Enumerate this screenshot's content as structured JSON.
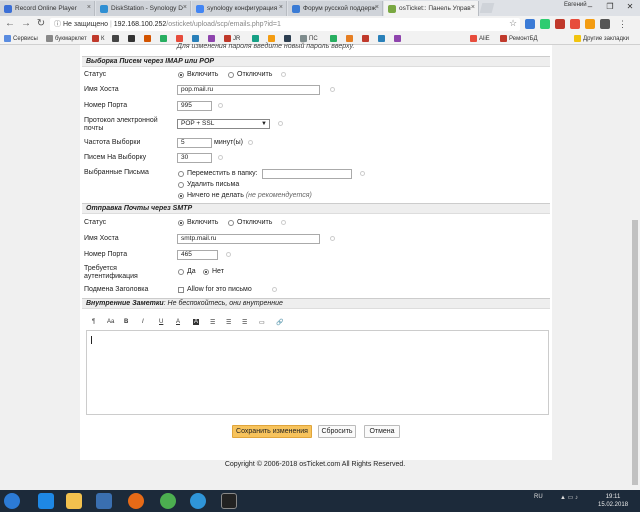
{
  "browser": {
    "tabs": [
      {
        "title": "Record Online Player",
        "favcolor": "#3b6fd6"
      },
      {
        "title": "DiskStation - Synology D",
        "favcolor": "#2f8fd3"
      },
      {
        "title": "synology конфигурация",
        "favcolor": "#4285f4"
      },
      {
        "title": "Форум русской поддерж",
        "favcolor": "#3a7bd5"
      },
      {
        "title": "osTicket:: Панель Управ",
        "favcolor": "#7aa842"
      }
    ],
    "user_label": "Евгений",
    "window_buttons": [
      "–",
      "❐",
      "✕"
    ],
    "url_security": "Не защищено",
    "url_host": "192.168.100.252",
    "url_path": "/osticket/upload/scp/emails.php?id=1"
  },
  "bookmarks": [
    {
      "label": "Сервисы",
      "color": "#5a8ce0"
    },
    {
      "label": "букмарклет",
      "color": "#888888"
    },
    {
      "label": "К",
      "color": "#c0392b"
    },
    {
      "label": "",
      "color": "#444444"
    },
    {
      "label": "",
      "color": "#333333"
    },
    {
      "label": "",
      "color": "#d35400"
    },
    {
      "label": "",
      "color": "#27ae60"
    },
    {
      "label": "",
      "color": "#e74c3c"
    },
    {
      "label": "",
      "color": "#2980b9"
    },
    {
      "label": "",
      "color": "#8e44ad"
    },
    {
      "label": "JR",
      "color": "#c0392b"
    },
    {
      "label": "",
      "color": "#16a085"
    },
    {
      "label": "",
      "color": "#f39c12"
    },
    {
      "label": "",
      "color": "#2c3e50"
    },
    {
      "label": "ПС",
      "color": "#7f8c8d"
    },
    {
      "label": "",
      "color": "#27ae60"
    },
    {
      "label": "",
      "color": "#e67e22"
    },
    {
      "label": "",
      "color": "#c0392b"
    },
    {
      "label": "",
      "color": "#2980b9"
    },
    {
      "label": "",
      "color": "#8e44ad"
    },
    {
      "label": "AliE",
      "color": "#e74c3c"
    },
    {
      "label": "РемонтБД",
      "color": "#c0392b"
    },
    {
      "label": "Другие закладки",
      "color": "#f1c40f"
    }
  ],
  "page": {
    "top_hint": "Для изменения пароля введите новый пароль вверху.",
    "imap": {
      "heading": "Выборка Писем через IMAP или POP",
      "status_label": "Статус",
      "status_on": "Включить",
      "status_off": "Отключить",
      "host_label": "Имя Хоста",
      "host_value": "pop.mail.ru",
      "port_label": "Номер Порта",
      "port_value": "995",
      "protocol_label_1": "Протокол электронной",
      "protocol_label_2": "почты",
      "protocol_value": "POP + SSL",
      "freq_label": "Частота Выборки",
      "freq_value": "5",
      "freq_unit": "минут(ы)",
      "perfetch_label": "Писем На Выборку",
      "perfetch_value": "30",
      "fetched_label": "Выбранные Письма",
      "opt_move": "Переместить в папку:",
      "opt_delete": "Удалить письма",
      "opt_nothing": "Ничего не делать",
      "opt_nothing_note": "(не рекомендуется)"
    },
    "smtp": {
      "heading": "Отправка Почты через SMTP",
      "status_label": "Статус",
      "status_on": "Включить",
      "status_off": "Отключить",
      "host_label": "Имя Хоста",
      "host_value": "smtp.mail.ru",
      "port_label": "Номер Порта",
      "port_value": "465",
      "auth_label_1": "Требуется",
      "auth_label_2": "аутентификация",
      "auth_yes": "Да",
      "auth_no": "Нет",
      "spoof_label": "Подмена Заголовка",
      "spoof_option": "Allow for это письмо"
    },
    "notes": {
      "heading": "Внутренние Заметки",
      "subheading": ": Не беспокойтесь, они внутренние",
      "toolbar": [
        "¶",
        "Aa",
        "B",
        "I",
        "U",
        "A",
        "A",
        "☰",
        "☰",
        "☰",
        "▭",
        "🔗"
      ]
    },
    "buttons": {
      "save": "Сохранить изменения",
      "reset": "Сбросить",
      "cancel": "Отмена"
    },
    "footer": "Copyright © 2006-2018 osTicket.com All Rights Reserved."
  },
  "taskbar": {
    "lang": "RU",
    "time": "19:11",
    "date": "15.02.2018"
  }
}
